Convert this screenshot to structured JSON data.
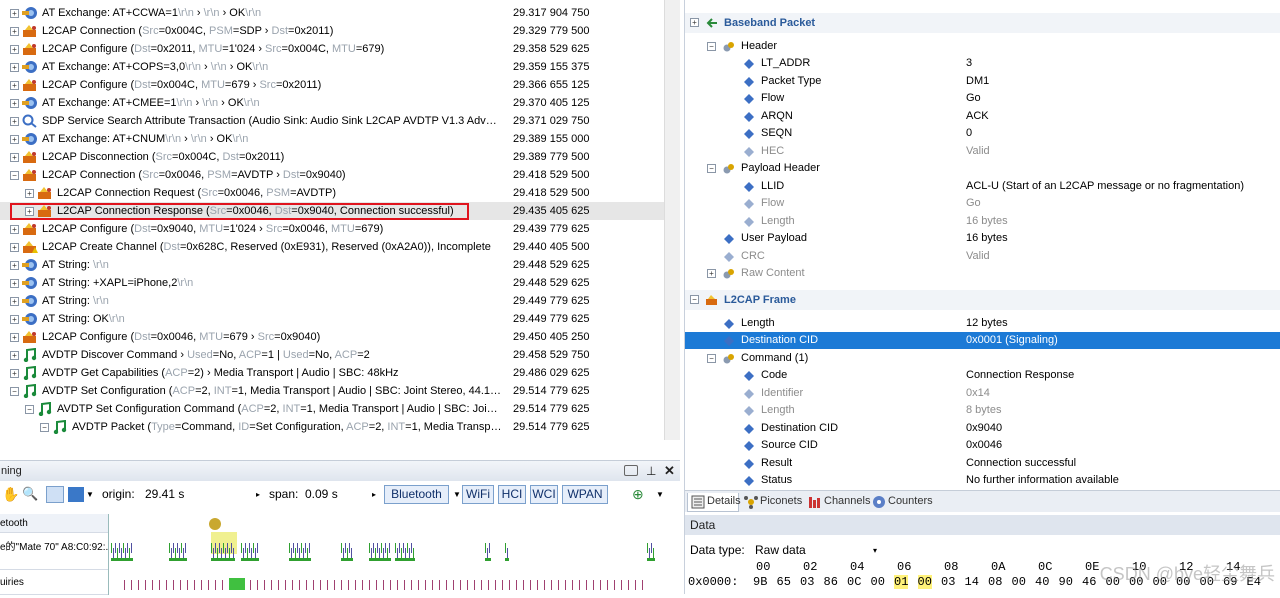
{
  "trace": {
    "rows": [
      {
        "indent": 0,
        "exp": "+",
        "icon": "exchange",
        "parts": [
          [
            "AT Exchange: AT+CCWA=1",
            0
          ],
          [
            "\\r\\n",
            1
          ],
          [
            " › ",
            0
          ],
          [
            "\\r\\n",
            1
          ],
          [
            " › OK",
            0
          ],
          [
            "\\r\\n",
            1
          ]
        ],
        "ts": "29.317 904 750"
      },
      {
        "indent": 0,
        "exp": "+",
        "icon": "l2cap",
        "parts": [
          [
            "L2CAP Connection (",
            0
          ],
          [
            "Src",
            1
          ],
          [
            "=0x004C, ",
            0
          ],
          [
            "PSM",
            1
          ],
          [
            "=SDP › ",
            0
          ],
          [
            "Dst",
            1
          ],
          [
            "=0x2011)",
            0
          ]
        ],
        "ts": "29.329 779 500"
      },
      {
        "indent": 0,
        "exp": "+",
        "icon": "l2cap",
        "parts": [
          [
            "L2CAP Configure (",
            0
          ],
          [
            "Dst",
            1
          ],
          [
            "=0x2011, ",
            0
          ],
          [
            "MTU",
            1
          ],
          [
            "=1'024 › ",
            0
          ],
          [
            "Src",
            1
          ],
          [
            "=0x004C, ",
            0
          ],
          [
            "MTU",
            1
          ],
          [
            "=679)",
            0
          ]
        ],
        "ts": "29.358 529 625"
      },
      {
        "indent": 0,
        "exp": "+",
        "icon": "exchange",
        "parts": [
          [
            "AT Exchange: AT+COPS=3,0",
            0
          ],
          [
            "\\r\\n",
            1
          ],
          [
            " › ",
            0
          ],
          [
            "\\r\\n",
            1
          ],
          [
            " › OK",
            0
          ],
          [
            "\\r\\n",
            1
          ]
        ],
        "ts": "29.359 155 375"
      },
      {
        "indent": 0,
        "exp": "+",
        "icon": "l2cap",
        "parts": [
          [
            "L2CAP Configure (",
            0
          ],
          [
            "Dst",
            1
          ],
          [
            "=0x004C, ",
            0
          ],
          [
            "MTU",
            1
          ],
          [
            "=679 › ",
            0
          ],
          [
            "Src",
            1
          ],
          [
            "=0x2011)",
            0
          ]
        ],
        "ts": "29.366 655 125"
      },
      {
        "indent": 0,
        "exp": "+",
        "icon": "exchange",
        "parts": [
          [
            "AT Exchange: AT+CMEE=1",
            0
          ],
          [
            "\\r\\n",
            1
          ],
          [
            " › ",
            0
          ],
          [
            "\\r\\n",
            1
          ],
          [
            " › OK",
            0
          ],
          [
            "\\r\\n",
            1
          ]
        ],
        "ts": "29.370 405 125"
      },
      {
        "indent": 0,
        "exp": "+",
        "icon": "sdp",
        "parts": [
          [
            "SDP Service Search Attribute Transaction (Audio Sink: Audio Sink L2CAP AVDTP V1.3 Advanced ...",
            0
          ]
        ],
        "ts": "29.371 029 750"
      },
      {
        "indent": 0,
        "exp": "+",
        "icon": "exchange",
        "parts": [
          [
            "AT Exchange: AT+CNUM",
            0
          ],
          [
            "\\r\\n",
            1
          ],
          [
            " › ",
            0
          ],
          [
            "\\r\\n",
            1
          ],
          [
            " › OK",
            0
          ],
          [
            "\\r\\n",
            1
          ]
        ],
        "ts": "29.389 155 000"
      },
      {
        "indent": 0,
        "exp": "+",
        "icon": "l2cap",
        "parts": [
          [
            "L2CAP Disconnection (",
            0
          ],
          [
            "Src",
            1
          ],
          [
            "=0x004C, ",
            0
          ],
          [
            "Dst",
            1
          ],
          [
            "=0x2011)",
            0
          ]
        ],
        "ts": "29.389 779 500"
      },
      {
        "indent": 0,
        "exp": "−",
        "icon": "l2cap",
        "parts": [
          [
            "L2CAP Connection (",
            0
          ],
          [
            "Src",
            1
          ],
          [
            "=0x0046, ",
            0
          ],
          [
            "PSM",
            1
          ],
          [
            "=AVDTP › ",
            0
          ],
          [
            "Dst",
            1
          ],
          [
            "=0x9040)",
            0
          ]
        ],
        "ts": "29.418 529 500"
      },
      {
        "indent": 1,
        "exp": "+",
        "icon": "l2cap",
        "parts": [
          [
            "L2CAP Connection Request (",
            0
          ],
          [
            "Src",
            1
          ],
          [
            "=0x0046, ",
            0
          ],
          [
            "PSM",
            1
          ],
          [
            "=AVDTP)",
            0
          ]
        ],
        "ts": "29.418 529 500"
      },
      {
        "indent": 1,
        "exp": "+",
        "icon": "l2cap",
        "sel": true,
        "parts": [
          [
            "L2CAP Connection Response (",
            0
          ],
          [
            "Src",
            1
          ],
          [
            "=0x0046, ",
            0
          ],
          [
            "Dst",
            1
          ],
          [
            "=0x9040, Connection successful)",
            0
          ]
        ],
        "ts": "29.435 405 625"
      },
      {
        "indent": 0,
        "exp": "+",
        "icon": "l2cap",
        "parts": [
          [
            "L2CAP Configure (",
            0
          ],
          [
            "Dst",
            1
          ],
          [
            "=0x9040, ",
            0
          ],
          [
            "MTU",
            1
          ],
          [
            "=1'024 › ",
            0
          ],
          [
            "Src",
            1
          ],
          [
            "=0x0046, ",
            0
          ],
          [
            "MTU",
            1
          ],
          [
            "=679)",
            0
          ]
        ],
        "ts": "29.439 779 625"
      },
      {
        "indent": 0,
        "exp": "+",
        "icon": "l2capwarn",
        "parts": [
          [
            "L2CAP Create Channel (",
            0
          ],
          [
            "Dst",
            1
          ],
          [
            "=0x628C, Reserved (0xE931), Reserved (0xA2A0)), Incomplete",
            0
          ]
        ],
        "ts": "29.440 405 500"
      },
      {
        "indent": 0,
        "exp": "+",
        "icon": "exchange",
        "parts": [
          [
            "AT String: ",
            0
          ],
          [
            "\\r\\n",
            1
          ]
        ],
        "ts": "29.448 529 625"
      },
      {
        "indent": 0,
        "exp": "+",
        "icon": "exchange",
        "parts": [
          [
            "AT String: +XAPL=iPhone,2",
            0
          ],
          [
            "\\r\\n",
            1
          ]
        ],
        "ts": "29.448 529 625"
      },
      {
        "indent": 0,
        "exp": "+",
        "icon": "exchange",
        "parts": [
          [
            "AT String: ",
            0
          ],
          [
            "\\r\\n",
            1
          ]
        ],
        "ts": "29.449 779 625"
      },
      {
        "indent": 0,
        "exp": "+",
        "icon": "exchange",
        "parts": [
          [
            "AT String: OK",
            0
          ],
          [
            "\\r\\n",
            1
          ]
        ],
        "ts": "29.449 779 625"
      },
      {
        "indent": 0,
        "exp": "+",
        "icon": "l2cap",
        "parts": [
          [
            "L2CAP Configure (",
            0
          ],
          [
            "Dst",
            1
          ],
          [
            "=0x0046, ",
            0
          ],
          [
            "MTU",
            1
          ],
          [
            "=679 › ",
            0
          ],
          [
            "Src",
            1
          ],
          [
            "=0x9040)",
            0
          ]
        ],
        "ts": "29.450 405 250"
      },
      {
        "indent": 0,
        "exp": "+",
        "icon": "avdtp",
        "parts": [
          [
            "AVDTP Discover Command › ",
            0
          ],
          [
            "Used",
            1
          ],
          [
            "=No, ",
            0
          ],
          [
            "ACP",
            1
          ],
          [
            "=1 | ",
            0
          ],
          [
            "Used",
            1
          ],
          [
            "=No, ",
            0
          ],
          [
            "ACP",
            1
          ],
          [
            "=2",
            0
          ]
        ],
        "ts": "29.458 529 750"
      },
      {
        "indent": 0,
        "exp": "+",
        "icon": "avdtp",
        "parts": [
          [
            "AVDTP Get Capabilities (",
            0
          ],
          [
            "ACP",
            1
          ],
          [
            "=2) › Media Transport | Audio | SBC: 48kHz",
            0
          ]
        ],
        "ts": "29.486 029 625"
      },
      {
        "indent": 0,
        "exp": "−",
        "icon": "avdtp",
        "parts": [
          [
            "AVDTP Set Configuration (",
            0
          ],
          [
            "ACP",
            1
          ],
          [
            "=2, ",
            0
          ],
          [
            "INT",
            1
          ],
          [
            "=1, Media Transport | Audio | SBC: Joint Stereo, 44.1kHz, ...",
            0
          ]
        ],
        "ts": "29.514 779 625"
      },
      {
        "indent": 1,
        "exp": "−",
        "icon": "avdtp",
        "parts": [
          [
            "AVDTP Set Configuration Command (",
            0
          ],
          [
            "ACP",
            1
          ],
          [
            "=2, ",
            0
          ],
          [
            "INT",
            1
          ],
          [
            "=1, Media Transport | Audio | SBC: Joint Ste...",
            0
          ]
        ],
        "ts": "29.514 779 625"
      },
      {
        "indent": 2,
        "exp": "−",
        "icon": "avdtp",
        "parts": [
          [
            "AVDTP Packet (",
            0
          ],
          [
            "Type",
            1
          ],
          [
            "=Command, ",
            0
          ],
          [
            "ID",
            1
          ],
          [
            "=Set Configuration, ",
            0
          ],
          [
            "ACP",
            1
          ],
          [
            "=2, ",
            0
          ],
          [
            "INT",
            1
          ],
          [
            "=1, Media Transport | ...",
            0
          ]
        ],
        "ts": "29.514 779 625"
      }
    ]
  },
  "timing": {
    "title": "ning",
    "origin_label": "origin:",
    "origin_value": "29.41 s",
    "span_label": "span:",
    "span_value": "0.09 s",
    "filters": [
      "Bluetooth",
      "WiFi",
      "HCI",
      "WCI",
      "WPAN"
    ],
    "lanes": [
      "etooth",
      "e的\"Mate 70\" A8:C0:92:...",
      "uiries"
    ]
  },
  "detail": {
    "top_label": "Baseband Packet",
    "frame_label": "L2CAP Frame",
    "rows": [
      {
        "lvl": 0,
        "exp": "+",
        "nm": "Baseband Packet",
        "vl": "",
        "sec": true
      },
      {
        "lvl": 1,
        "exp": "−",
        "nm": "Header",
        "vl": ""
      },
      {
        "lvl": 2,
        "nm": "LT_ADDR",
        "vl": "3"
      },
      {
        "lvl": 2,
        "nm": "Packet Type",
        "vl": "DM1"
      },
      {
        "lvl": 2,
        "nm": "Flow",
        "vl": "Go"
      },
      {
        "lvl": 2,
        "nm": "ARQN",
        "vl": "ACK"
      },
      {
        "lvl": 2,
        "nm": "SEQN",
        "vl": "0"
      },
      {
        "lvl": 2,
        "nm": "HEC",
        "vl": "Valid",
        "dim": true
      },
      {
        "lvl": 1,
        "exp": "−",
        "nm": "Payload Header",
        "vl": ""
      },
      {
        "lvl": 2,
        "nm": "LLID",
        "vl": "ACL-U (Start of an L2CAP message or no fragmentation)"
      },
      {
        "lvl": 2,
        "nm": "Flow",
        "vl": "Go",
        "dim": true
      },
      {
        "lvl": 2,
        "nm": "Length",
        "vl": "16 bytes",
        "dim": true
      },
      {
        "lvl": 1,
        "nm": "User Payload",
        "vl": "16 bytes"
      },
      {
        "lvl": 1,
        "nm": "CRC",
        "vl": "Valid",
        "dim": true
      },
      {
        "lvl": 1,
        "exp": "+",
        "nm": "Raw Content",
        "vl": "",
        "dim": true
      },
      {
        "lvl": 0,
        "exp": "−",
        "nm": "L2CAP Frame",
        "vl": "",
        "sec": true
      },
      {
        "lvl": 1,
        "nm": "Length",
        "vl": "12 bytes"
      },
      {
        "lvl": 1,
        "nm": "Destination CID",
        "vl": "0x0001 (Signaling)",
        "hl": true
      },
      {
        "lvl": 1,
        "exp": "−",
        "nm": "Command (1)",
        "vl": ""
      },
      {
        "lvl": 2,
        "nm": "Code",
        "vl": "Connection Response"
      },
      {
        "lvl": 2,
        "nm": "Identifier",
        "vl": "0x14",
        "dim": true
      },
      {
        "lvl": 2,
        "nm": "Length",
        "vl": "8 bytes",
        "dim": true
      },
      {
        "lvl": 2,
        "nm": "Destination CID",
        "vl": "0x9040"
      },
      {
        "lvl": 2,
        "nm": "Source CID",
        "vl": "0x0046"
      },
      {
        "lvl": 2,
        "nm": "Result",
        "vl": "Connection successful"
      },
      {
        "lvl": 2,
        "nm": "Status",
        "vl": "No further information available"
      }
    ]
  },
  "tabs": [
    "Details",
    "Piconets",
    "Channels",
    "Counters"
  ],
  "data": {
    "header": "Data",
    "type_label": "Data type:",
    "type_value": "Raw data",
    "offsets": [
      "00",
      "02",
      "04",
      "06",
      "08",
      "0A",
      "0C",
      "0E",
      "10",
      "12",
      "14"
    ],
    "address": "0x0000:",
    "bytes": [
      "9B",
      "65",
      "03",
      "86",
      "0C",
      "00",
      "01",
      "00",
      "03",
      "14",
      "08",
      "00",
      "40",
      "90",
      "46",
      "00",
      "00",
      "00",
      "00",
      "00",
      "69",
      "E4"
    ],
    "hl_bytes": [
      6,
      7
    ]
  },
  "watermark": "CSDN @bye轻尘舞兵"
}
